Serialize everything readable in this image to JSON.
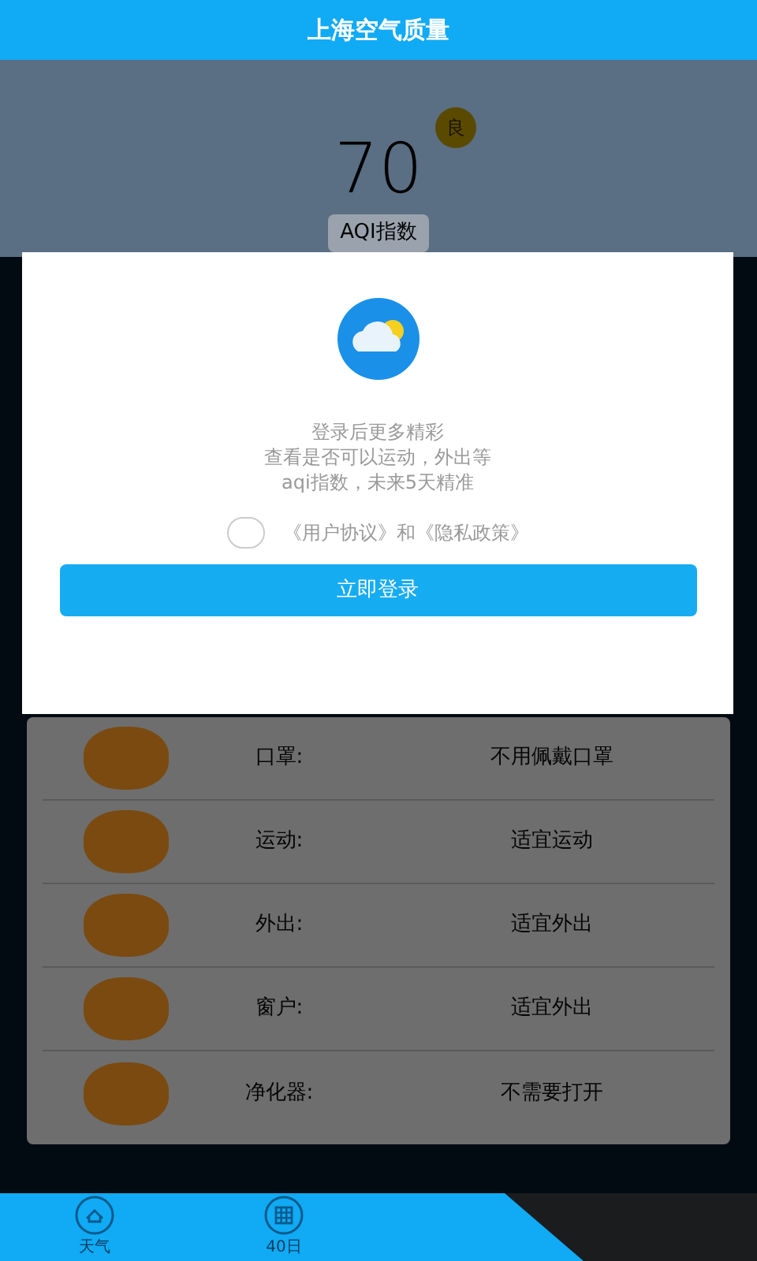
{
  "header": {
    "title": "上海空气质量"
  },
  "aqi": {
    "value": "70",
    "grade": "良",
    "label": "AQI指数"
  },
  "advice": [
    {
      "label": "口罩:",
      "value": "不用佩戴口罩"
    },
    {
      "label": "运动:",
      "value": "适宜运动"
    },
    {
      "label": "外出:",
      "value": "适宜外出"
    },
    {
      "label": "窗户:",
      "value": "适宜外出"
    },
    {
      "label": "净化器:",
      "value": "不需要打开"
    }
  ],
  "tab_bar": [
    {
      "label": "天气",
      "kind": "weather",
      "selected": false
    },
    {
      "label": "40日",
      "kind": "calendar",
      "selected": false
    }
  ],
  "login_dialog": {
    "lines": [
      "登录后更多精彩",
      "查看是否可以运动，外出等",
      "aqi指数，未来5天精准"
    ],
    "agreement": {
      "checked": false,
      "text": "《用户协议》和《隐私政策》"
    },
    "button": "立即登录"
  }
}
